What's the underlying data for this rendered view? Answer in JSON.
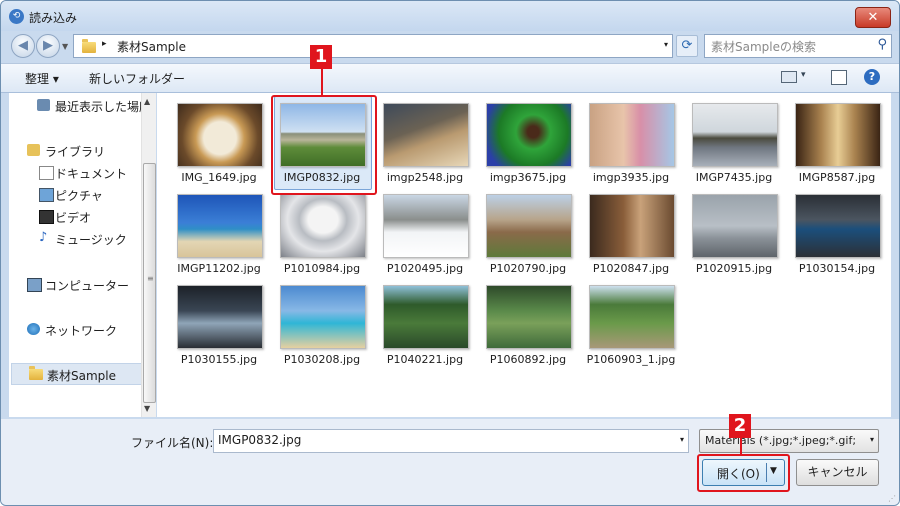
{
  "window": {
    "title": "読み込み",
    "close": "✕",
    "app_icon": "⟲"
  },
  "address": {
    "path": "素材Sample",
    "separator": "▸",
    "dropdown": "▾",
    "search_placeholder": "素材Sampleの検索"
  },
  "toolbar": {
    "organize": "整理 ▾",
    "new_folder": "新しいフォルダー",
    "view_dd": "▾",
    "help": "?"
  },
  "sidebar": {
    "recent": "最近表示した場所",
    "libraries": "ライブラリ",
    "documents": "ドキュメント",
    "pictures": "ピクチャ",
    "videos": "ビデオ",
    "music": "ミュージック",
    "computer": "コンピューター",
    "network": "ネットワーク",
    "current": "素材Sample"
  },
  "files": [
    {
      "name": "IMG_1649.jpg"
    },
    {
      "name": "IMGP0832.jpg",
      "selected": true
    },
    {
      "name": "imgp2548.jpg"
    },
    {
      "name": "imgp3675.jpg"
    },
    {
      "name": "imgp3935.jpg"
    },
    {
      "name": "IMGP7435.jpg"
    },
    {
      "name": "IMGP8587.jpg"
    },
    {
      "name": "IMGP11202.jpg"
    },
    {
      "name": "P1010984.jpg"
    },
    {
      "name": "P1020495.jpg"
    },
    {
      "name": "P1020790.jpg"
    },
    {
      "name": "P1020847.jpg"
    },
    {
      "name": "P1020915.jpg"
    },
    {
      "name": "P1030154.jpg"
    },
    {
      "name": "P1030155.jpg"
    },
    {
      "name": "P1030208.jpg"
    },
    {
      "name": "P1040221.jpg"
    },
    {
      "name": "P1060892.jpg"
    },
    {
      "name": "P1060903_1.jpg"
    }
  ],
  "bottom": {
    "filename_label": "ファイル名(N):",
    "filename_value": "IMGP0832.jpg",
    "file_type": "Materials (*.jpg;*.jpeg;*.gif;",
    "open_label": "開く(O)",
    "cancel_label": "キャンセル"
  },
  "callouts": {
    "one": "1",
    "two": "2"
  },
  "colors": {
    "callout": "#e0151d",
    "selection": "#dbe9f8"
  }
}
